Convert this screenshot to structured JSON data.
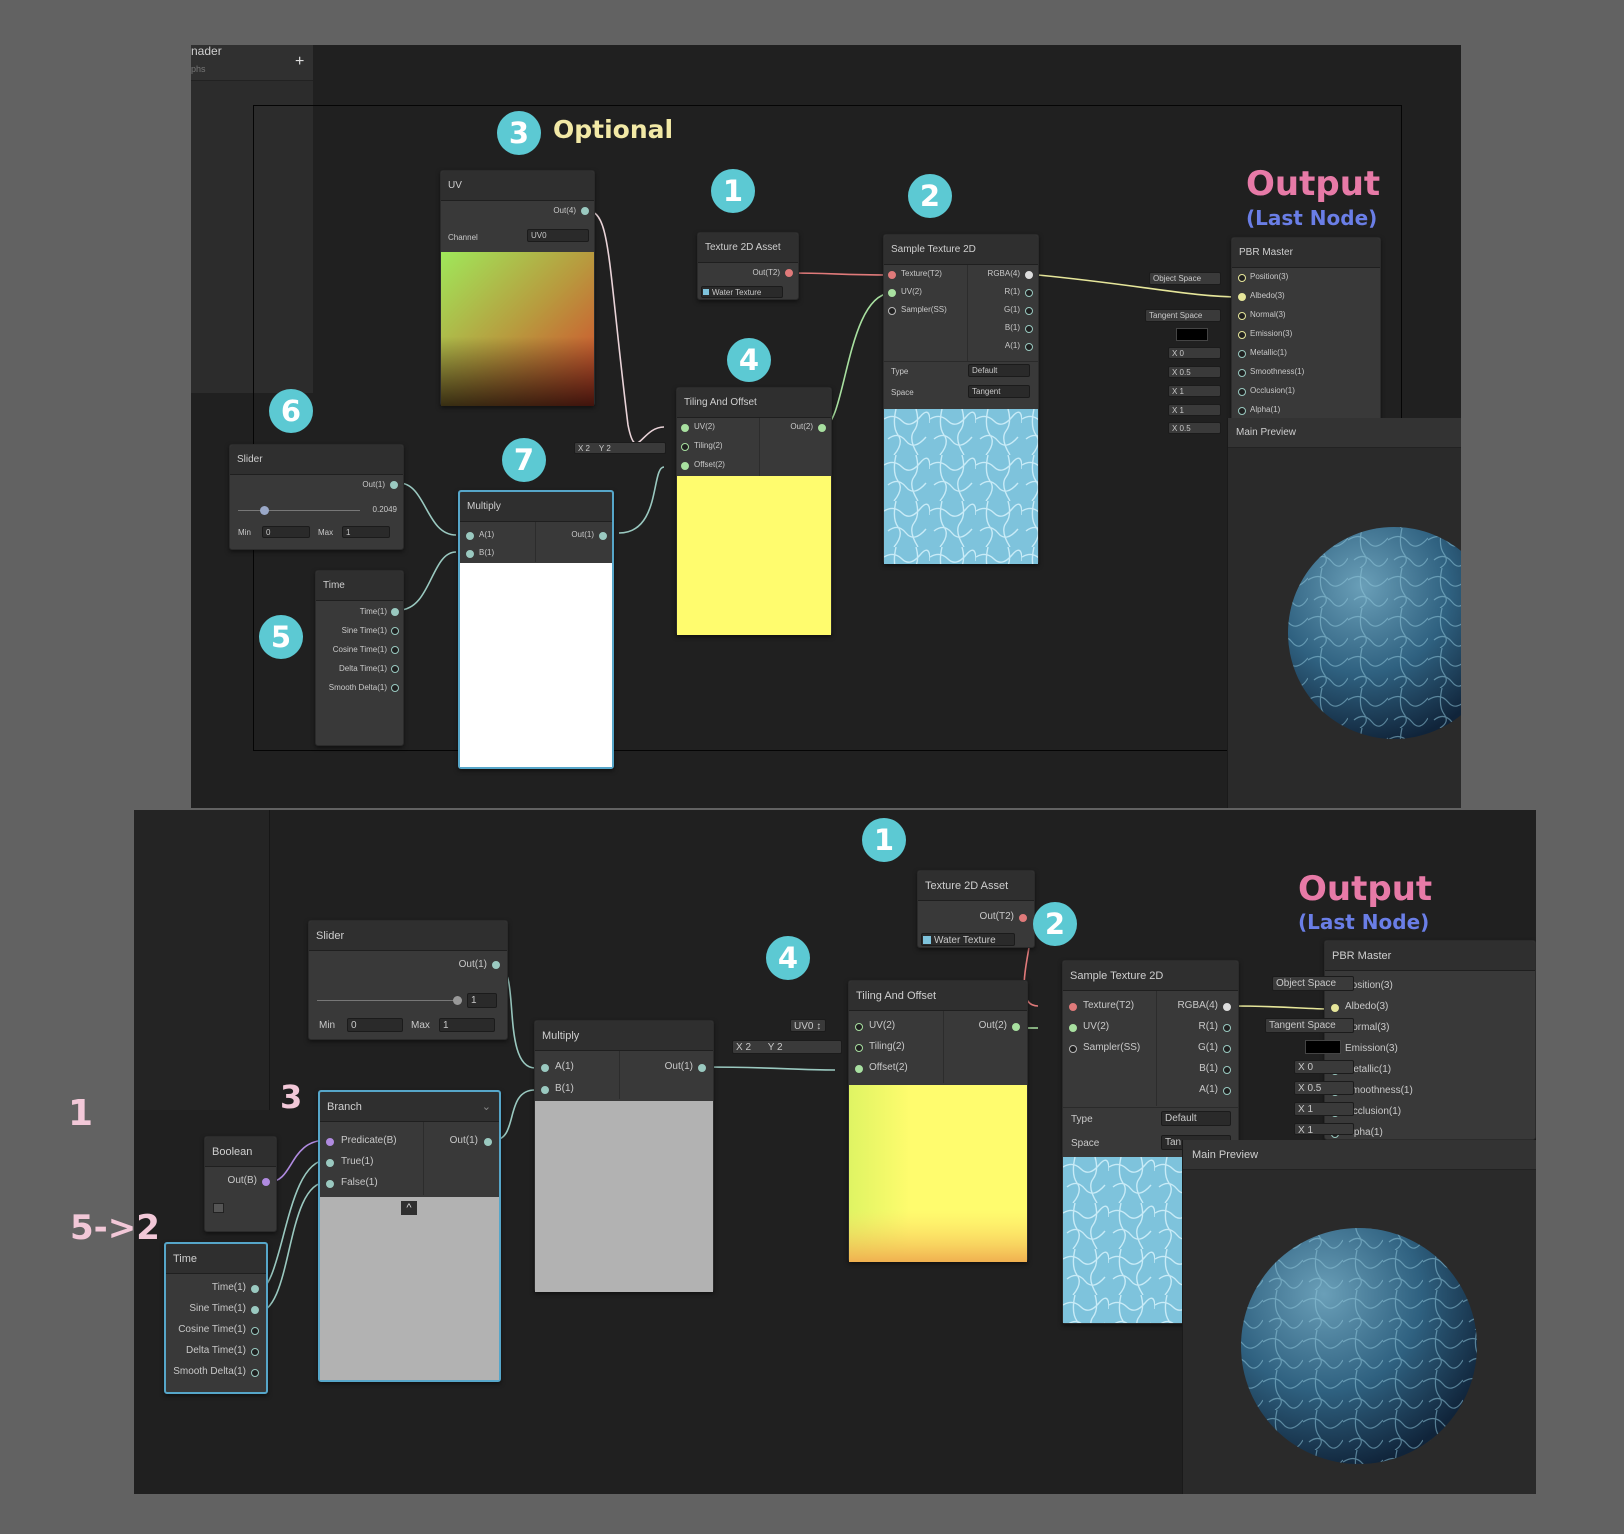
{
  "colors": {
    "badge": "#5cc9d3",
    "output_pink": "#e77aa7",
    "output_blue": "#6a7ee6",
    "optional": "#f2e9a6",
    "steps_pink": "#f2c8d8",
    "canvas": "#202020",
    "frame": "#626262"
  },
  "top": {
    "sidebar": {
      "title": "nader",
      "subtitle": "phs",
      "add": "+"
    },
    "annotations": {
      "optional": "Optional",
      "output": "Output",
      "last_node": "(Last Node)"
    },
    "badges": {
      "b1": "1",
      "b2": "2",
      "b3": "3",
      "b4": "4",
      "b5": "5",
      "b6": "6",
      "b7": "7"
    },
    "uv": {
      "title": "UV",
      "out": "Out(4)",
      "channel_label": "Channel",
      "channel_value": "UV0"
    },
    "tex_asset": {
      "title": "Texture 2D Asset",
      "out": "Out(T2)",
      "value": "Water Texture"
    },
    "sample": {
      "title": "Sample Texture 2D",
      "in": [
        "Texture(T2)",
        "UV(2)",
        "Sampler(SS)"
      ],
      "out": [
        "RGBA(4)",
        "R(1)",
        "G(1)",
        "B(1)",
        "A(1)"
      ],
      "type_label": "Type",
      "type_value": "Default",
      "space_label": "Space",
      "space_value": "Tangent"
    },
    "tiling": {
      "title": "Tiling And Offset",
      "in": [
        "UV(2)",
        "Tiling(2)",
        "Offset(2)"
      ],
      "out": "Out(2)",
      "x": "X  2",
      "y": "Y  2"
    },
    "slider": {
      "title": "Slider",
      "out": "Out(1)",
      "value": "0.2049",
      "min_label": "Min",
      "min": "0",
      "max_label": "Max",
      "max": "1"
    },
    "multiply": {
      "title": "Multiply",
      "in": [
        "A(1)",
        "B(1)"
      ],
      "out": "Out(1)"
    },
    "time": {
      "title": "Time",
      "out": [
        "Time(1)",
        "Sine Time(1)",
        "Cosine Time(1)",
        "Delta Time(1)",
        "Smooth Delta(1)"
      ]
    },
    "pbr": {
      "title": "PBR Master",
      "in": [
        "Position(3)",
        "Albedo(3)",
        "Normal(3)",
        "Emission(3)",
        "Metallic(1)",
        "Smoothness(1)",
        "Occlusion(1)",
        "Alpha(1)"
      ],
      "object_space": "Object Space",
      "tangent_space": "Tangent Space",
      "x_values": [
        "X  0",
        "X  0.5",
        "X  1",
        "X  1",
        "X  0.5"
      ]
    },
    "preview": {
      "title": "Main Preview"
    }
  },
  "bottom": {
    "annotations": {
      "output": "Output",
      "last_node": "(Last Node)",
      "step1": "1",
      "step2": "5->2",
      "badge3": "3"
    },
    "badges": {
      "b1": "1",
      "b2": "2",
      "b4": "4"
    },
    "slider": {
      "title": "Slider",
      "out": "Out(1)",
      "value": "1",
      "min_label": "Min",
      "min": "0",
      "max_label": "Max",
      "max": "1"
    },
    "multiply": {
      "title": "Multiply",
      "in": [
        "A(1)",
        "B(1)"
      ],
      "out": "Out(1)"
    },
    "branch": {
      "title": "Branch",
      "in": [
        "Predicate(B)",
        "True(1)",
        "False(1)"
      ],
      "out": "Out(1)",
      "chevron": "⌄"
    },
    "boolean": {
      "title": "Boolean",
      "out": "Out(B)"
    },
    "time": {
      "title": "Time",
      "out": [
        "Time(1)",
        "Sine Time(1)",
        "Cosine Time(1)",
        "Delta Time(1)",
        "Smooth Delta(1)"
      ]
    },
    "tiling": {
      "title": "Tiling And Offset",
      "in": [
        "UV(2)",
        "Tiling(2)",
        "Offset(2)"
      ],
      "out": "Out(2)",
      "uv": "UV0 ↕",
      "x": "X  2",
      "y": "Y  2"
    },
    "tex_asset": {
      "title": "Texture 2D Asset",
      "out": "Out(T2)",
      "value": "Water Texture"
    },
    "sample": {
      "title": "Sample Texture 2D",
      "in": [
        "Texture(T2)",
        "UV(2)",
        "Sampler(SS)"
      ],
      "out": [
        "RGBA(4)",
        "R(1)",
        "G(1)",
        "B(1)",
        "A(1)"
      ],
      "type_label": "Type",
      "type_value": "Default",
      "space_label": "Space",
      "space_value": "Tan"
    },
    "pbr": {
      "title": "PBR Master",
      "in": [
        "Position(3)",
        "Albedo(3)",
        "Normal(3)",
        "Emission(3)",
        "Metallic(1)",
        "Smoothness(1)",
        "Occlusion(1)",
        "Alpha(1)"
      ],
      "object_space": "Object Space",
      "tangent_space": "Tangent Space",
      "x_values": [
        "X  0",
        "X  0.5",
        "X  1",
        "X  1"
      ]
    },
    "preview": {
      "title": "Main Preview"
    }
  }
}
